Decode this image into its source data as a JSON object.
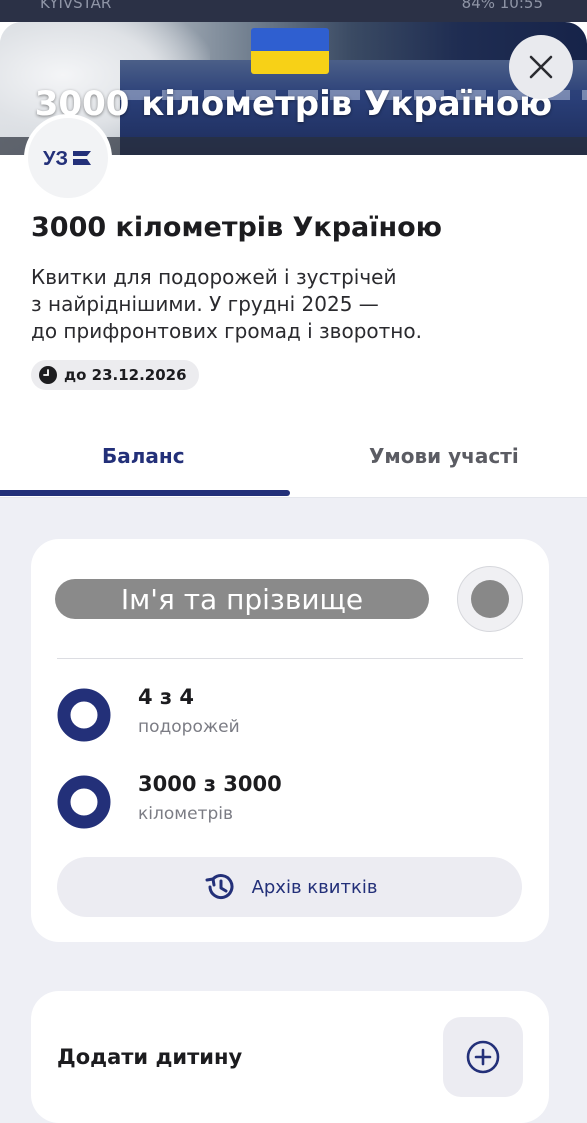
{
  "status_bar": {
    "left_text": "KYIVSTAR",
    "right_text": "84% 10:55"
  },
  "hero": {
    "title": "3000 кілометрів Україною",
    "flag": {
      "top": "#2f5fd0",
      "bottom": "#f7d117"
    }
  },
  "logo": {
    "text": "УЗ"
  },
  "campaign": {
    "title": "3000 кілометрів Україною",
    "description_lines": [
      "Квитки для подорожей і зустрічей",
      "з найріднішими. У грудні 2025 —",
      "до прифронтових громад і зворотно."
    ],
    "deadline": "до 23.12.2026",
    "deadline_icon": "clock-icon"
  },
  "tabs": [
    {
      "label": "Баланс",
      "active": true
    },
    {
      "label": "Умови участі",
      "active": false
    }
  ],
  "balance_card": {
    "name_placeholder": "Ім'я та прізвище",
    "stats": [
      {
        "value": "4 з 4",
        "unit": "подорожей",
        "progress": 1.0
      },
      {
        "value": "3000 з 3000",
        "unit": "кілометрів",
        "progress": 1.0
      }
    ],
    "archive_button": {
      "label": "Архів квитків",
      "icon": "history-icon"
    }
  },
  "child_card": {
    "label": "Додати дитину",
    "button_icon": "plus-circle-icon"
  },
  "colors": {
    "accent": "#233079",
    "background": "#eeeff5",
    "card": "#ffffff"
  }
}
